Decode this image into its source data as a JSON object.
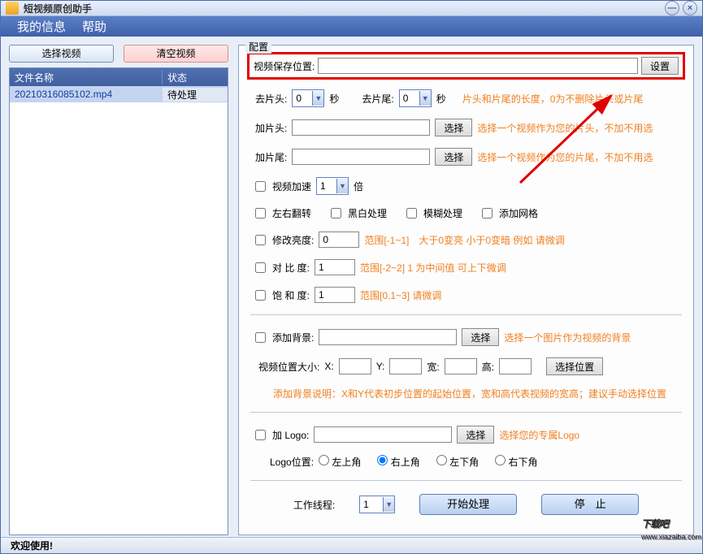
{
  "app_title": "短视频原创助手",
  "menu": {
    "info": "我的信息",
    "help": "帮助"
  },
  "left": {
    "select_video": "选择视频",
    "clear_video": "清空视频",
    "col_filename": "文件名称",
    "col_status": "状态",
    "rows": [
      {
        "name": "20210316085102.mp4",
        "status": "待处理"
      }
    ]
  },
  "config": {
    "title": "配置",
    "save_label": "视频保存位置:",
    "save_value": "",
    "set_btn": "设置",
    "trim_head": "去片头:",
    "trim_head_val": "0",
    "sec": "秒",
    "trim_tail": "去片尾:",
    "trim_tail_val": "0",
    "trim_hint": "片头和片尾的长度，0为不删除片头或片尾",
    "add_head": "加片头:",
    "add_head_val": "",
    "choose": "选择",
    "add_head_hint": "选择一个视频作为您的片头，不加不用选",
    "add_tail": "加片尾:",
    "add_tail_val": "",
    "add_tail_hint": "选择一个视频作为您的片尾，不加不用选",
    "speed": "视频加速",
    "speed_val": "1",
    "speed_unit": "倍",
    "flip": "左右翻转",
    "bw": "黑白处理",
    "blur": "模糊处理",
    "grid": "添加网格",
    "brightness": "修改亮度:",
    "brightness_val": "0",
    "brightness_hint": "范围[-1~1]　大于0变亮 小于0变暗  例如 请微调",
    "contrast": "对 比  度:",
    "contrast_val": "1",
    "contrast_hint": "范围[-2~2]  1 为中间值  可上下微调",
    "saturation": "饱 和  度:",
    "saturation_val": "1",
    "saturation_hint": "范围[0.1~3]  请微调",
    "add_bg": "添加背景:",
    "add_bg_val": "",
    "add_bg_hint": "选择一个图片作为视频的背景",
    "pos_label": "视频位置大小:",
    "x": "X:",
    "y": "Y:",
    "w": "宽:",
    "h": "高:",
    "choose_pos": "选择位置",
    "bg_explain": "添加背景说明：X和Y代表初步位置的起始位置，宽和高代表视频的宽高；建议手动选择位置",
    "add_logo": "加 Logo:",
    "add_logo_val": "",
    "add_logo_hint": "选择您的专属Logo",
    "logo_pos": "Logo位置:",
    "pos_tl": "左上角",
    "pos_tr": "右上角",
    "pos_bl": "左下角",
    "pos_br": "右下角",
    "threads": "工作线程:",
    "threads_val": "1",
    "start": "开始处理",
    "stop": "停　止"
  },
  "statusbar": "欢迎使用!",
  "watermark": {
    "main": "下载吧",
    "sub": "www.xiazaiba.com"
  }
}
